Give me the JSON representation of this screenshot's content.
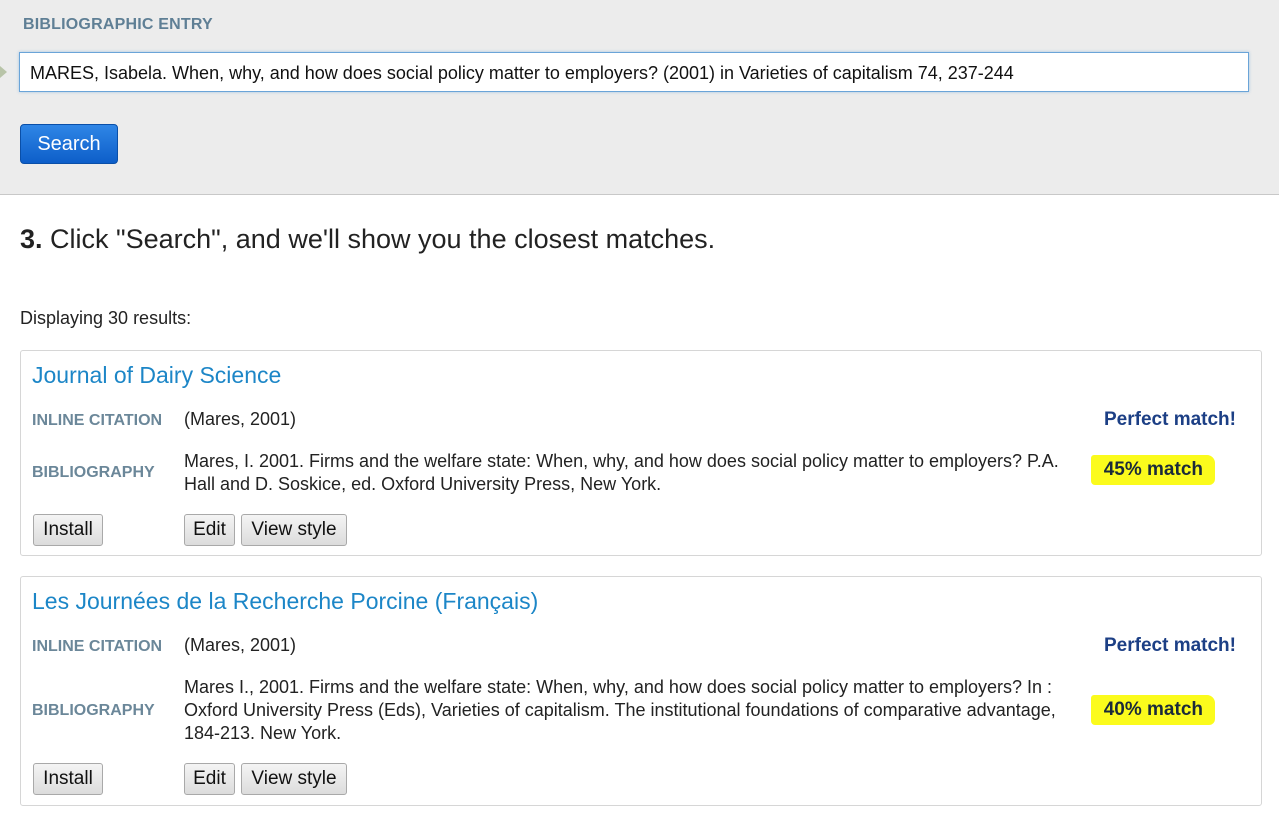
{
  "entry": {
    "label": "BIBLIOGRAPHIC ENTRY",
    "value": "MARES, Isabela. When, why, and how does social policy matter to employers? (2001) in Varieties of capitalism 74, 237-244",
    "search_label": "Search"
  },
  "step": {
    "number": "3.",
    "text": "Click \"Search\", and we'll show you the closest matches."
  },
  "results_count": "Displaying 30 results:",
  "labels": {
    "inline_citation": "INLINE CITATION",
    "bibliography": "BIBLIOGRAPHY",
    "install": "Install",
    "edit": "Edit",
    "view_style": "View style"
  },
  "results": [
    {
      "title": "Journal of Dairy Science",
      "inline_citation": "(Mares, 2001)",
      "inline_match": "Perfect match!",
      "bibliography": "Mares, I. 2001. Firms and the welfare state: When, why, and how does social policy matter to employers? P.A. Hall and D. Soskice, ed. Oxford University Press, New York.",
      "bibliography_match": "45% match"
    },
    {
      "title": "Les Journées de la Recherche Porcine (Français)",
      "inline_citation": "(Mares, 2001)",
      "inline_match": "Perfect match!",
      "bibliography": "Mares I., 2001. Firms and the welfare state: When, why, and how does social policy matter to employers? In : Oxford University Press (Eds), Varieties of capitalism. The institutional foundations of comparative advantage, 184-213. New York.",
      "bibliography_match": "40% match"
    }
  ],
  "colors": {
    "link": "#1c86c7",
    "match_text": "#1c3f85",
    "highlight": "#fbfb1c",
    "label": "#6b8799",
    "search_button": "#0d5ec9"
  }
}
